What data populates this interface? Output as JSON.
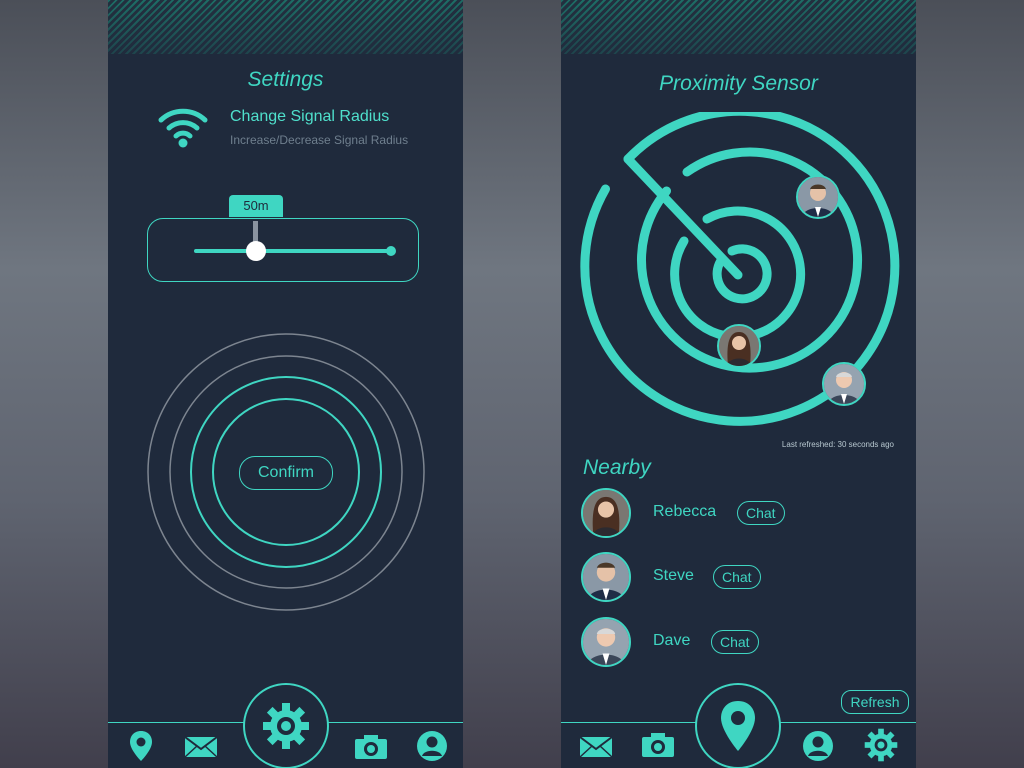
{
  "settings_screen": {
    "title": "Settings",
    "setting": {
      "title": "Change Signal Radius",
      "subtitle": "Increase/Decrease Signal Radius",
      "icon": "wifi-icon"
    },
    "slider": {
      "value_label": "50m",
      "fraction": 0.3
    },
    "confirm_label": "Confirm",
    "nav": [
      "location-pin-icon",
      "mail-icon",
      "settings-gear-icon",
      "camera-icon",
      "user-icon"
    ],
    "active_nav": "settings-gear-icon"
  },
  "proximity_screen": {
    "title": "Proximity Sensor",
    "last_refreshed": "Last refreshed: 30 seconds ago",
    "nearby_title": "Nearby",
    "people": [
      {
        "name": "Rebecca",
        "chat_label": "Chat"
      },
      {
        "name": "Steve",
        "chat_label": "Chat"
      },
      {
        "name": "Dave",
        "chat_label": "Chat"
      }
    ],
    "refresh_label": "Refresh",
    "nav": [
      "mail-icon",
      "camera-icon",
      "location-pin-icon",
      "user-icon",
      "settings-gear-icon"
    ],
    "active_nav": "location-pin-icon"
  },
  "colors": {
    "accent": "#3fd6c2",
    "background": "#1f2a3c",
    "muted": "#6f7f8e"
  }
}
